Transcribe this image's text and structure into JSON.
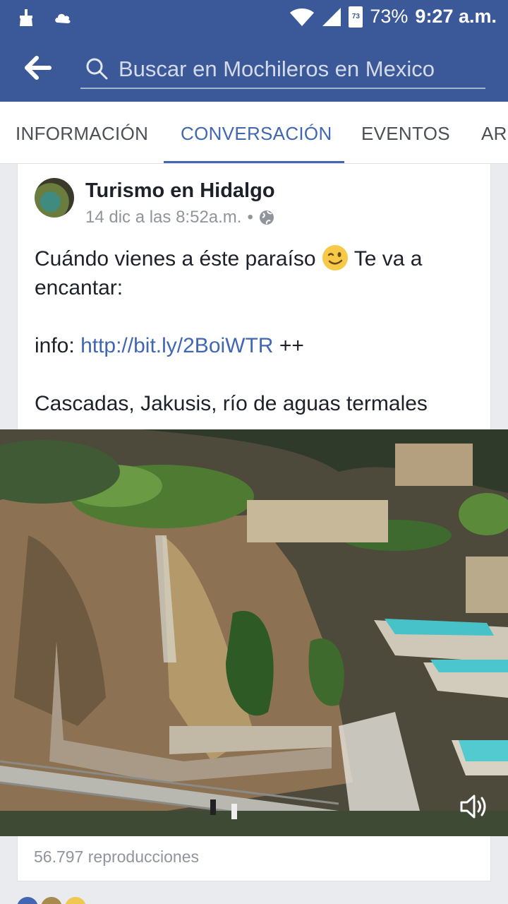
{
  "status_bar": {
    "battery_percent": "73%",
    "battery_badge": "73",
    "time": "9:27 a.m."
  },
  "app_bar": {
    "search_placeholder": "Buscar en Mochileros en Mexico"
  },
  "tabs": [
    {
      "label": "INFORMACIÓN",
      "active": false
    },
    {
      "label": "CONVERSACIÓN",
      "active": true
    },
    {
      "label": "EVENTOS",
      "active": false
    },
    {
      "label": "ARCHIVOS",
      "active": false
    }
  ],
  "post": {
    "author": "Turismo en Hidalgo",
    "timestamp": "14 dic a las 8:52a.m.",
    "separator": "•",
    "text_line1_before": "Cuándo vienes a éste paraíso",
    "text_line1_after": "Te va a encantar:",
    "info_label": "info:",
    "info_link": "http://bit.ly/2BoiWTR",
    "info_suffix": "++",
    "text_line3": "Cascadas, Jakusis, río  de aguas termales",
    "views": "56.797 reproducciones"
  },
  "colors": {
    "brand": "#3b5998",
    "accent": "#4267b2"
  },
  "icons": [
    "cleaner-icon",
    "cloud-icon",
    "wifi-icon",
    "signal-icon",
    "battery-icon",
    "back-arrow-icon",
    "search-icon",
    "globe-icon",
    "wink-emoji-icon",
    "volume-icon"
  ]
}
